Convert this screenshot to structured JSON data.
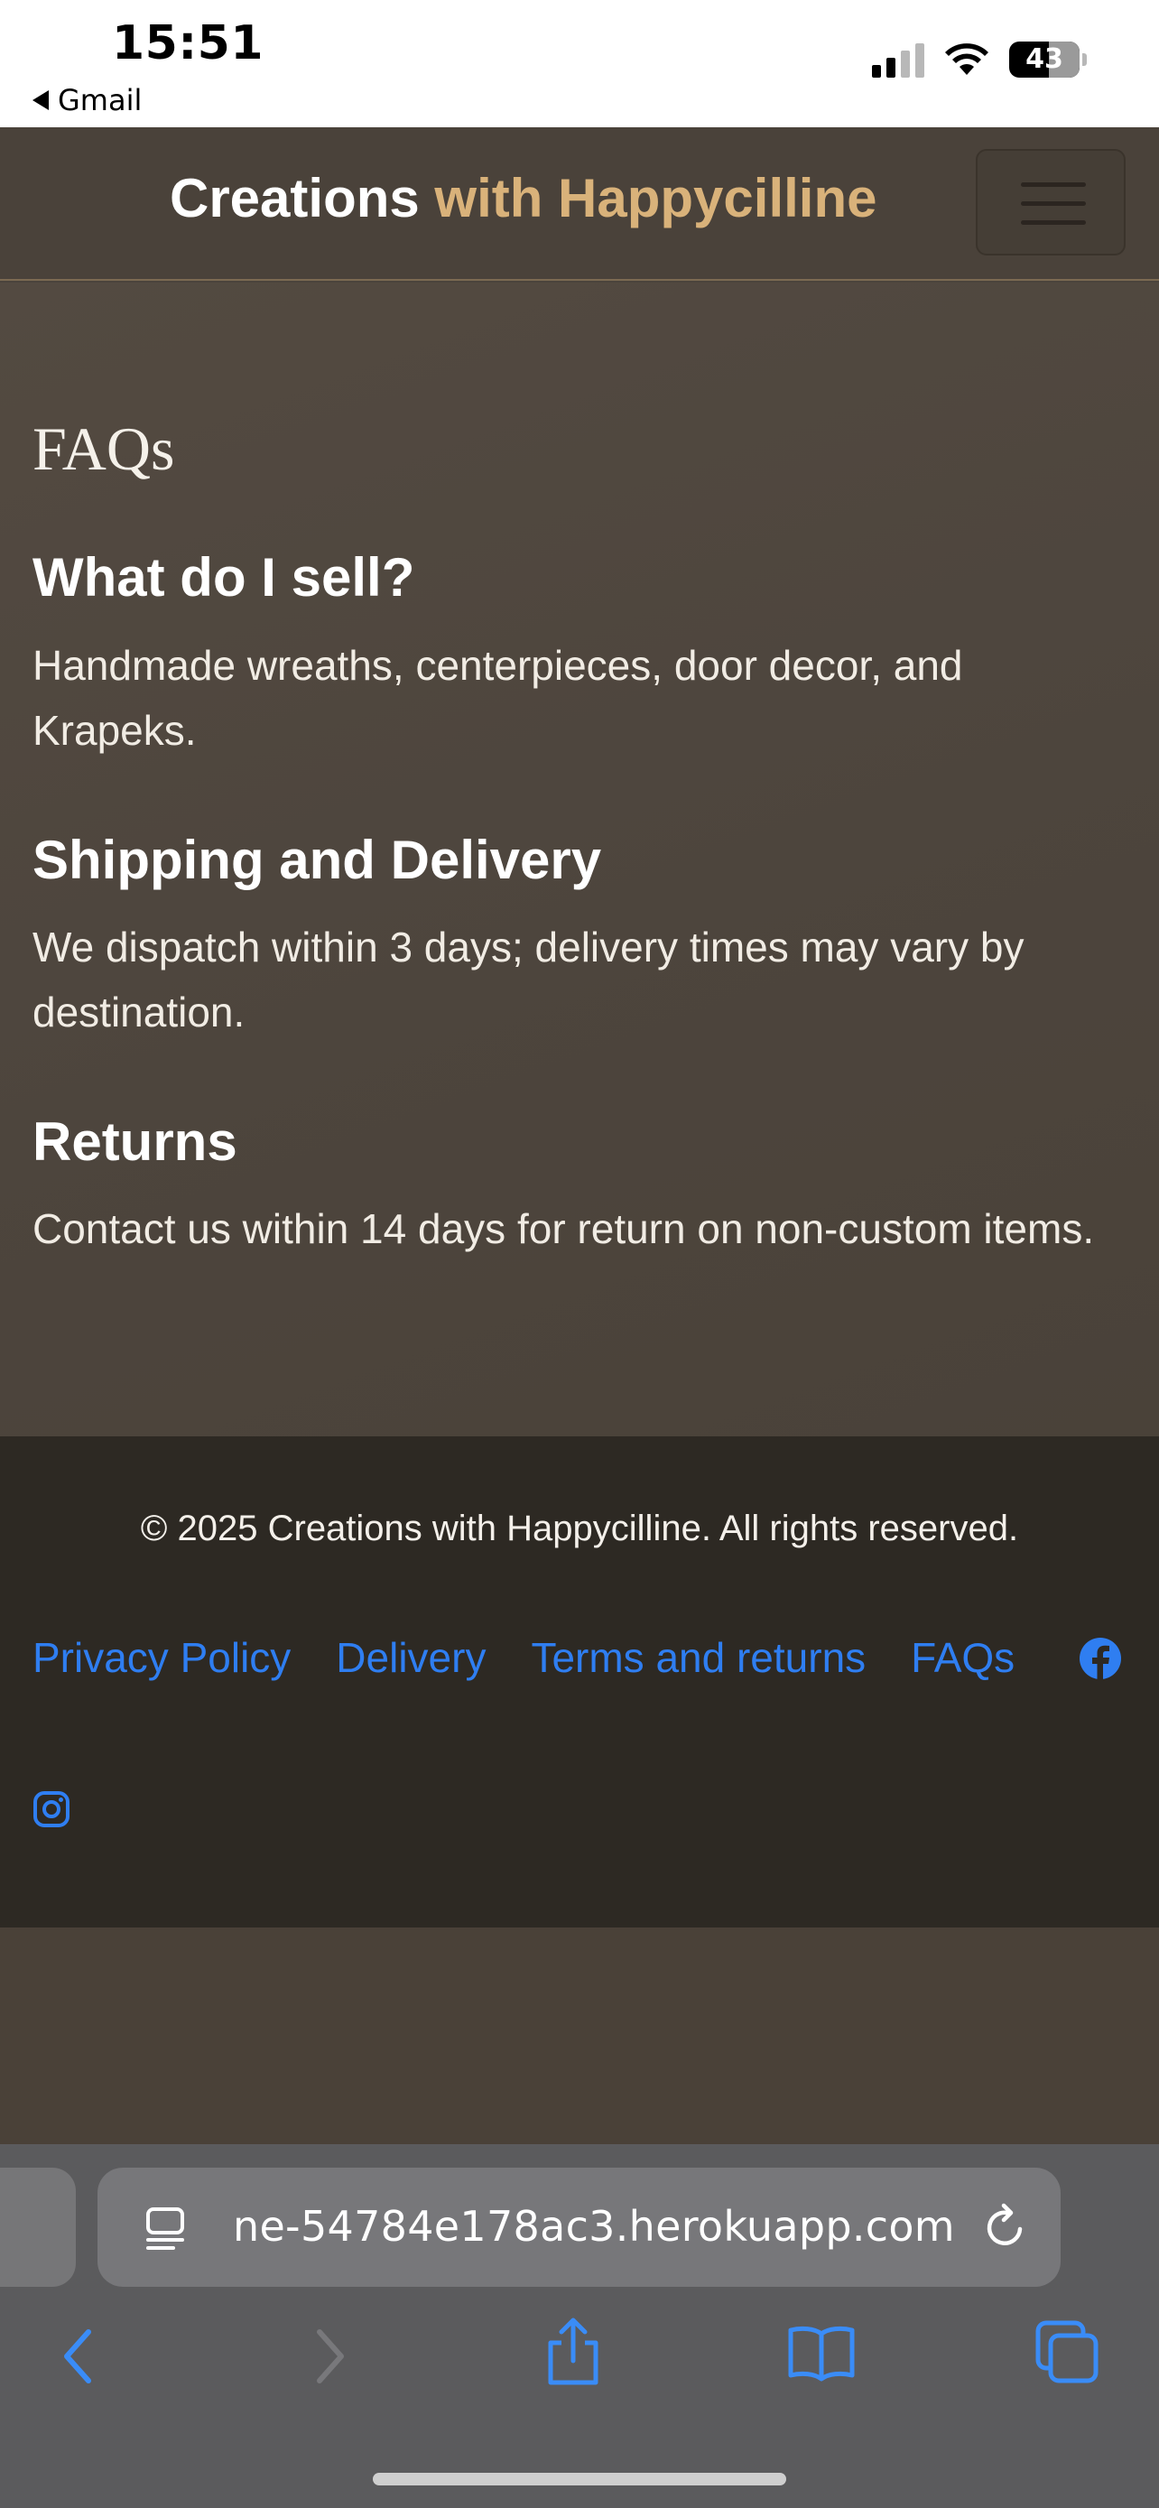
{
  "status_bar": {
    "time": "15:51",
    "back_app": "Gmail",
    "battery": "43"
  },
  "navbar": {
    "brand_first": "Creations",
    "brand_second": " with Happycilline",
    "accent_color": "#d9b27a",
    "menu_icon": "hamburger-menu-icon"
  },
  "faq": {
    "title": "FAQs",
    "items": [
      {
        "question": "What do I sell?",
        "answer": "Handmade wreaths, centerpieces, door decor, and Krapeks."
      },
      {
        "question": "Shipping and Delivery",
        "answer": "We dispatch within 3 days; delivery times may vary by destination."
      },
      {
        "question": "Returns",
        "answer": "Contact us within 14 days for return on non-custom items."
      }
    ]
  },
  "footer": {
    "copyright": "© 2025 Creations with Happycilline. All rights reserved.",
    "links": [
      "Privacy Policy",
      "Delivery",
      "Terms and returns",
      "FAQs"
    ],
    "link_color": "#2f7ef1",
    "social_icons": [
      "facebook-icon",
      "instagram-icon"
    ]
  },
  "browser": {
    "url": "ne-54784e178ac3.herokuapp.com",
    "toolbar_icons": [
      "back-icon",
      "forward-icon",
      "share-icon",
      "bookmarks-icon",
      "tabs-icon"
    ]
  }
}
